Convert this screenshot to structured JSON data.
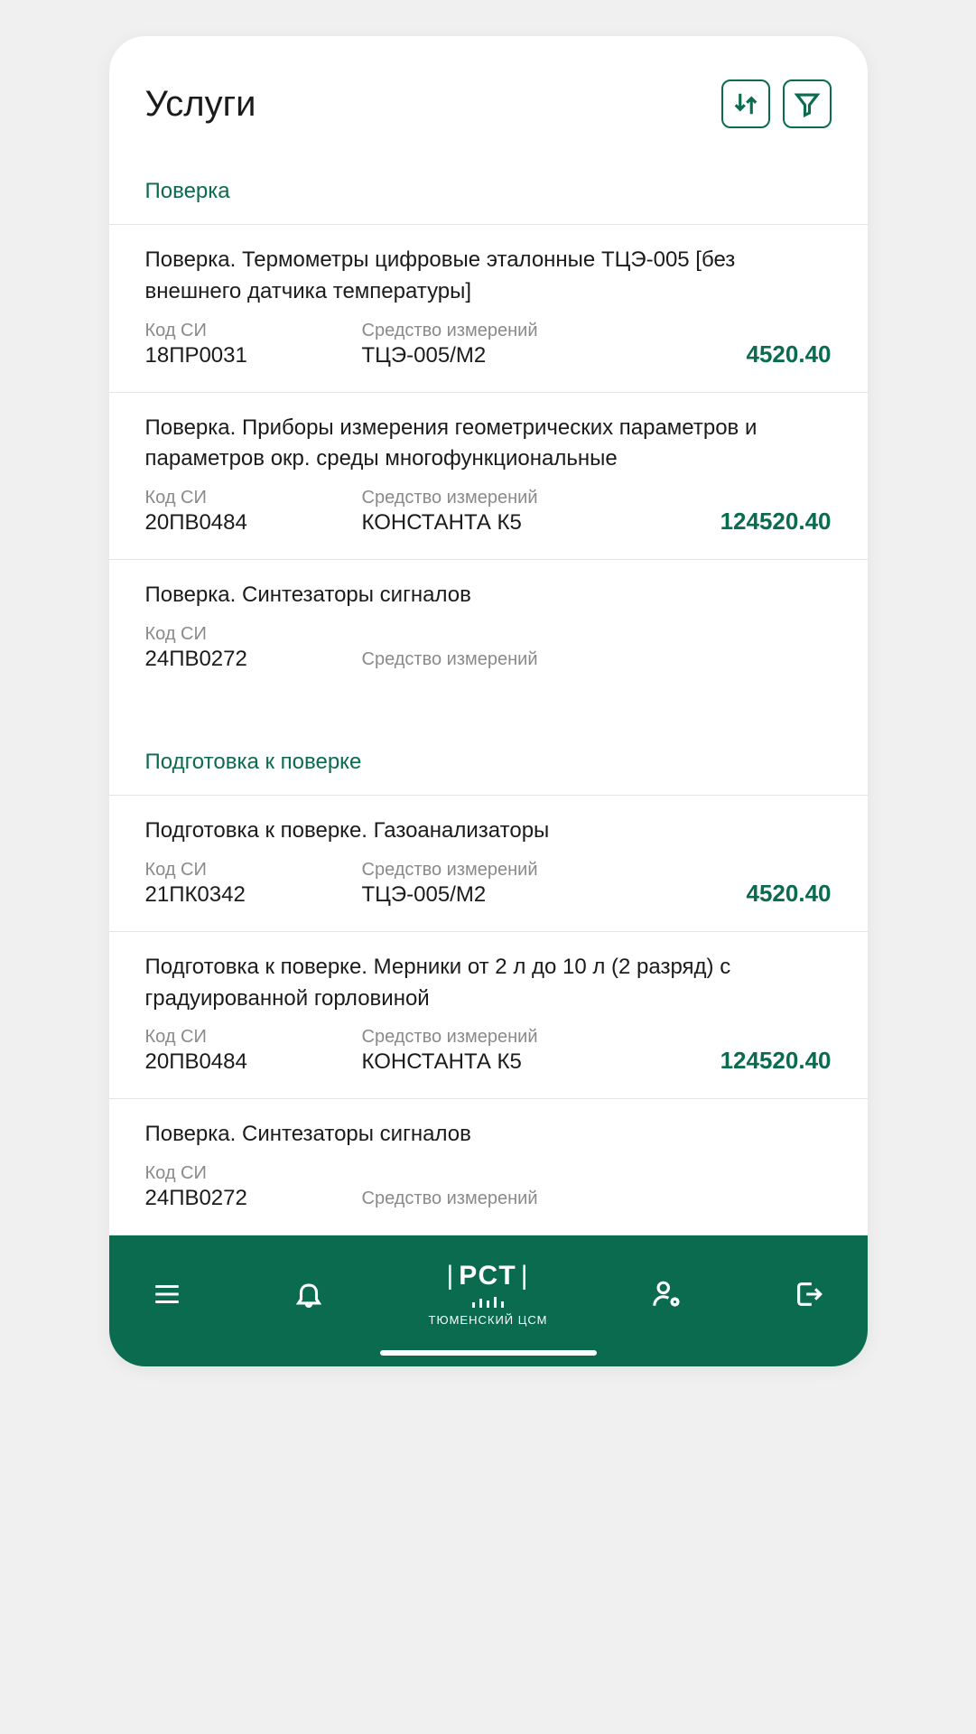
{
  "header": {
    "title": "Услуги"
  },
  "labels": {
    "code": "Код СИ",
    "device": "Средство измерений"
  },
  "nav": {
    "logo_main": "РСТ",
    "logo_sub": "ТЮМЕНСКИЙ ЦСМ"
  },
  "sections": [
    {
      "title": "Поверка",
      "items": [
        {
          "title": "Поверка. Термометры цифровые эталонные ТЦЭ-005 [без внешнего датчика температуры]",
          "code": "18ПР0031",
          "device": "ТЦЭ-005/М2",
          "price": "4520.40"
        },
        {
          "title": "Поверка. Приборы измерения геометрических параметров и параметров окр. среды многофункциональные",
          "code": "20ПВ0484",
          "device": "КОНСТАНТА К5",
          "price": "124520.40"
        },
        {
          "title": "Поверка. Синтезаторы сигналов",
          "code": "24ПВ0272",
          "device": "",
          "price": ""
        }
      ]
    },
    {
      "title": "Подготовка к поверке",
      "items": [
        {
          "title": "Подготовка к поверке. Газоанализаторы",
          "code": "21ПК0342",
          "device": "ТЦЭ-005/М2",
          "price": "4520.40"
        },
        {
          "title": "Подготовка к поверке. Мерники от 2 л до 10 л (2 разряд) с градуированной горловиной",
          "code": "20ПВ0484",
          "device": "КОНСТАНТА К5",
          "price": "124520.40"
        },
        {
          "title": "Поверка. Синтезаторы сигналов",
          "code": "24ПВ0272",
          "device": "",
          "price": ""
        }
      ]
    }
  ]
}
